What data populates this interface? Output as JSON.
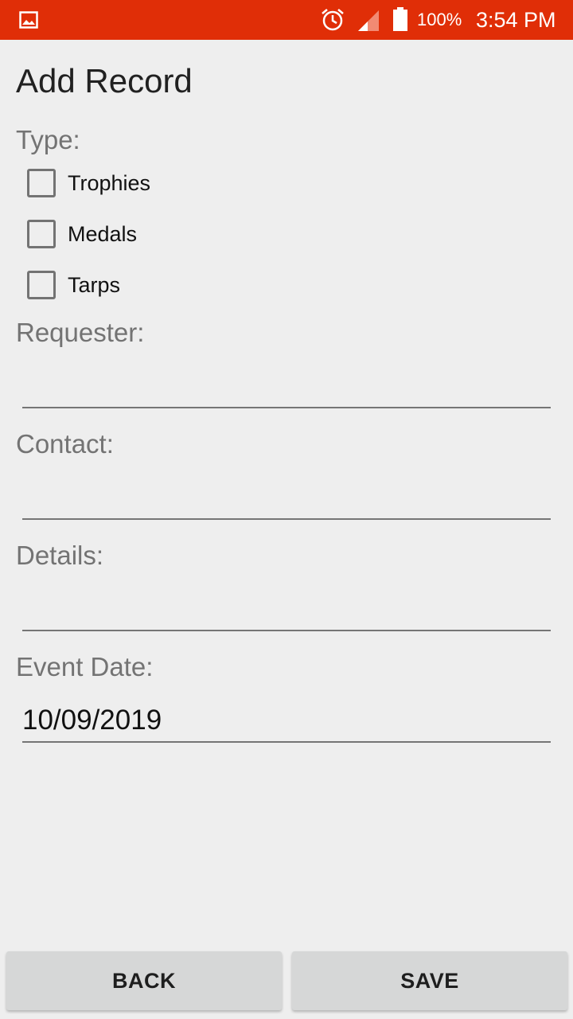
{
  "status_bar": {
    "battery_percent": "100%",
    "time": "3:54 PM",
    "background": "#e02e07",
    "icons": [
      "image-icon",
      "alarm-icon",
      "signal-icon",
      "battery-icon"
    ]
  },
  "form": {
    "title": "Add Record",
    "type_label": "Type:",
    "type_options": [
      {
        "label": "Trophies",
        "checked": false
      },
      {
        "label": "Medals",
        "checked": false
      },
      {
        "label": "Tarps",
        "checked": false
      }
    ],
    "requester_label": "Requester:",
    "requester_value": "",
    "contact_label": "Contact:",
    "contact_value": "",
    "details_label": "Details:",
    "details_value": "",
    "event_date_label": "Event Date:",
    "event_date_value": "10/09/2019"
  },
  "buttons": {
    "back_label": "BACK",
    "save_label": "SAVE"
  }
}
